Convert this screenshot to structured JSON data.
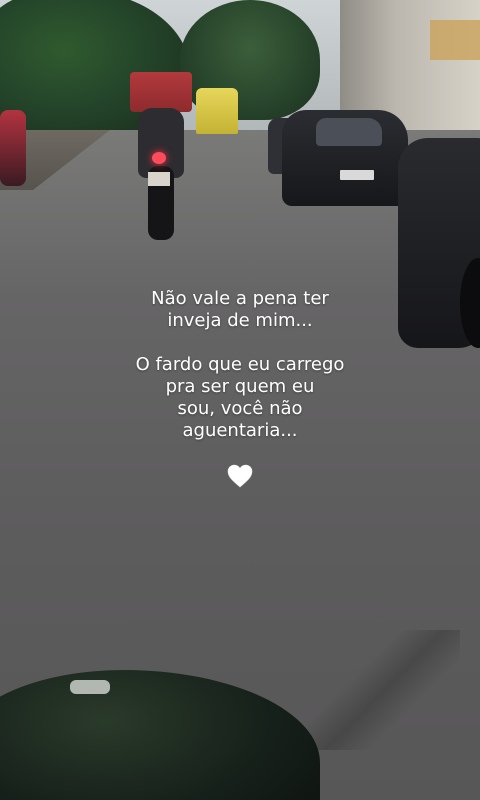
{
  "story": {
    "lines": [
      "Não vale a pena ter",
      "inveja de mim...",
      "",
      "O fardo que eu carrego",
      "pra ser quem eu",
      "sou, você não",
      "aguentaria..."
    ],
    "emoji": "white-heart",
    "emoji_color": "#ffffff"
  },
  "scene": {
    "description_icon_names": [
      "motorcycle",
      "car",
      "van",
      "trees",
      "buildings"
    ]
  }
}
